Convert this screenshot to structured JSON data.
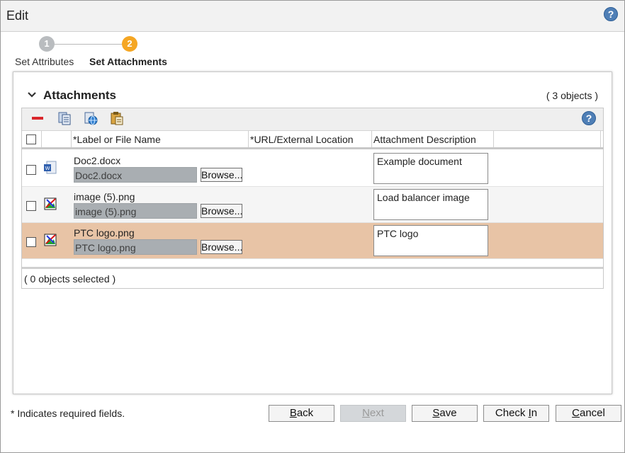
{
  "window": {
    "title": "Edit"
  },
  "wizard": {
    "steps": [
      {
        "number": "1",
        "label": "Set Attributes",
        "active": false,
        "color": "#b9bcbf"
      },
      {
        "number": "2",
        "label": "Set Attachments",
        "active": true,
        "color": "#f5a623"
      }
    ]
  },
  "attachments": {
    "section_title": "Attachments",
    "object_count": "( 3 objects )",
    "toolbar": {
      "icons": [
        "remove-icon",
        "copy-icon",
        "add-url-icon",
        "paste-icon",
        "help-icon"
      ]
    },
    "columns": [
      "*Label or File Name",
      "*URL/External Location",
      "Attachment Description"
    ],
    "rows": [
      {
        "label": "Doc2.docx",
        "file": "Doc2.docx",
        "browse": "Browse...",
        "url": "",
        "description": "Example document",
        "icon": "word-document-icon",
        "selected": false
      },
      {
        "label": "image (5).png",
        "file": "image (5).png",
        "browse": "Browse...",
        "url": "",
        "description": "Load balancer image",
        "icon": "image-file-icon",
        "selected": false
      },
      {
        "label": "PTC logo.png",
        "file": "PTC logo.png",
        "browse": "Browse...",
        "url": "",
        "description": "PTC logo",
        "icon": "image-file-icon",
        "selected": true
      }
    ],
    "selected_count": "( 0 objects selected )"
  },
  "footer": {
    "required_note": "* Indicates required fields.",
    "buttons": {
      "back": {
        "first": "B",
        "rest": "ack"
      },
      "next": {
        "first": "N",
        "rest": "ext"
      },
      "save": {
        "first": "S",
        "rest": "ave"
      },
      "checkin": {
        "pre": "Check ",
        "first": "I",
        "rest": "n"
      },
      "cancel": {
        "first": "C",
        "rest": "ancel"
      }
    }
  },
  "colors": {
    "selected_row": "#e8c4a6",
    "alt_row": "#f5f5f5",
    "help_blue": "#4f7fb6",
    "step_active": "#f5a623",
    "step_inactive": "#b9bcbf"
  }
}
